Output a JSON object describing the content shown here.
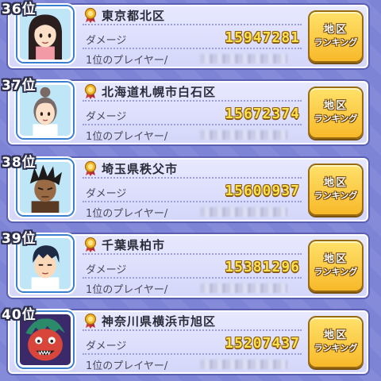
{
  "ranking": {
    "damage_label": "ダメージ",
    "player_label": "1位のプレイヤー/",
    "button_line1": "地区",
    "button_line2": "ランキング",
    "entries": [
      {
        "rank": "36位",
        "location": "東京都北区",
        "damage": "15947281",
        "avatar": "girl-black-hair-avatar"
      },
      {
        "rank": "37位",
        "location": "北海道札幌市白石区",
        "damage": "15672374",
        "avatar": "woman-bun-hair-avatar"
      },
      {
        "rank": "38位",
        "location": "埼玉県秩父市",
        "damage": "15600937",
        "avatar": "boy-spiky-hair-avatar"
      },
      {
        "rank": "39位",
        "location": "千葉県柏市",
        "damage": "15381296",
        "avatar": "boy-short-hair-avatar"
      },
      {
        "rank": "40位",
        "location": "神奈川県横浜市旭区",
        "damage": "15207437",
        "avatar": "red-face-creature-avatar"
      }
    ]
  },
  "colors": {
    "background": "#7d84d6",
    "card": "#e0e2fc",
    "damage_digits": "#ffe14a",
    "button": "#f7c637",
    "avatar_frame": "#3b7fd0"
  }
}
